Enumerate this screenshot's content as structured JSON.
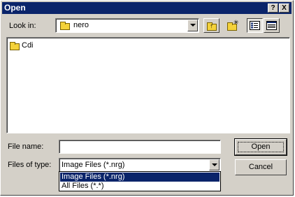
{
  "window": {
    "title": "Open",
    "help_button": "?",
    "close_button": "X"
  },
  "look_in": {
    "label": "Look in:",
    "value": "nero"
  },
  "toolbar": {
    "up_folder_icon": "up-folder-icon",
    "new_folder_icon": "new-folder-icon",
    "list_view_icon": "list-view-icon",
    "details_view_icon": "details-view-icon"
  },
  "files": [
    {
      "name": "Cdi",
      "icon": "folder-icon"
    }
  ],
  "file_name": {
    "label": "File name:",
    "value": ""
  },
  "files_of_type": {
    "label": "Files of type:",
    "value": "Image Files (*.nrg)",
    "options": [
      "Image Files (*.nrg)",
      "All Files (*.*)"
    ],
    "selected_index": 0
  },
  "buttons": {
    "open": "Open",
    "cancel": "Cancel"
  },
  "colors": {
    "titlebar": "#0a246a",
    "face": "#d4d0c8",
    "selection": "#0a246a"
  }
}
